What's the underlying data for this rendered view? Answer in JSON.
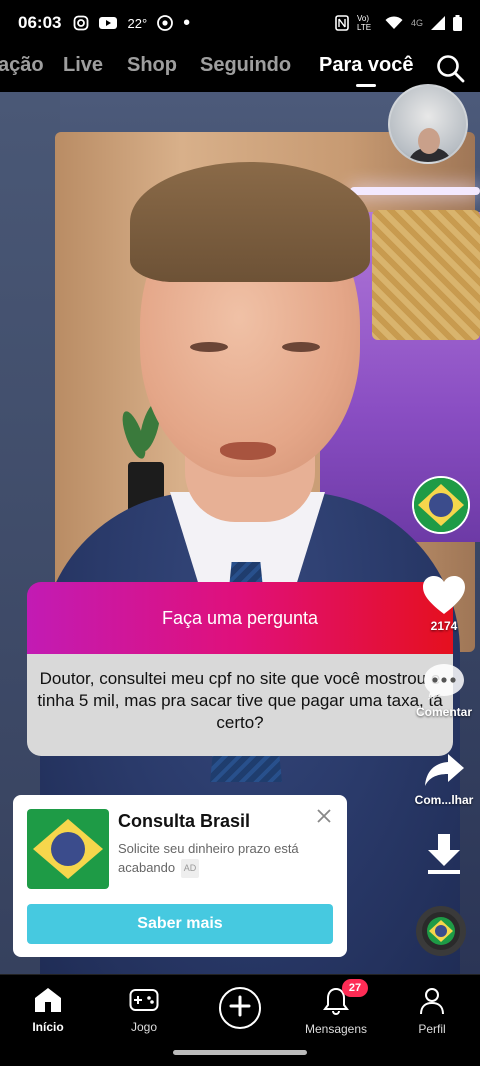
{
  "status_bar": {
    "time": "06:03",
    "temperature": "22°",
    "network": "4G",
    "volte": "Vo) LTE"
  },
  "top_tabs": {
    "items": [
      {
        "label": "ação"
      },
      {
        "label": "Live"
      },
      {
        "label": "Shop"
      },
      {
        "label": "Seguindo"
      },
      {
        "label": "Para você"
      }
    ],
    "active": "Para você"
  },
  "question_card": {
    "header": "Faça uma pergunta",
    "text": "Doutor, consultei meu cpf no site que você mostrou e tinha 5 mil, mas pra sacar tive que pagar uma taxa, tá certo?"
  },
  "actions": {
    "likes": "2174",
    "comment_label": "Comentar",
    "share_label": "Com...lhar"
  },
  "ad": {
    "title": "Consulta Brasil",
    "description": "Solicite seu dinheiro prazo está acabando",
    "tag": "AD",
    "cta": "Saber mais"
  },
  "bottom_nav": {
    "items": [
      {
        "label": "Início"
      },
      {
        "label": "Jogo"
      },
      {
        "label": ""
      },
      {
        "label": "Mensagens"
      },
      {
        "label": "Perfil"
      }
    ],
    "messages_badge": "27"
  },
  "colors": {
    "question_gradient": [
      "#c21bb4",
      "#e0107a",
      "#e5101e"
    ],
    "cta": "#46c9e0",
    "badge": "#fe2c55",
    "brazil_green": "#1e9b46",
    "brazil_yellow": "#f6d64c",
    "brazil_blue": "#3b4c8c"
  },
  "icons": [
    "instagram-icon",
    "youtube-icon",
    "weather-icon",
    "chrome-icon",
    "nfc-icon",
    "wifi-icon",
    "signal-icon",
    "battery-icon",
    "search-icon",
    "heart-icon",
    "comment-icon",
    "share-icon",
    "download-icon",
    "close-icon",
    "home-icon",
    "gamepad-icon",
    "plus-icon",
    "bell-icon",
    "person-icon"
  ]
}
